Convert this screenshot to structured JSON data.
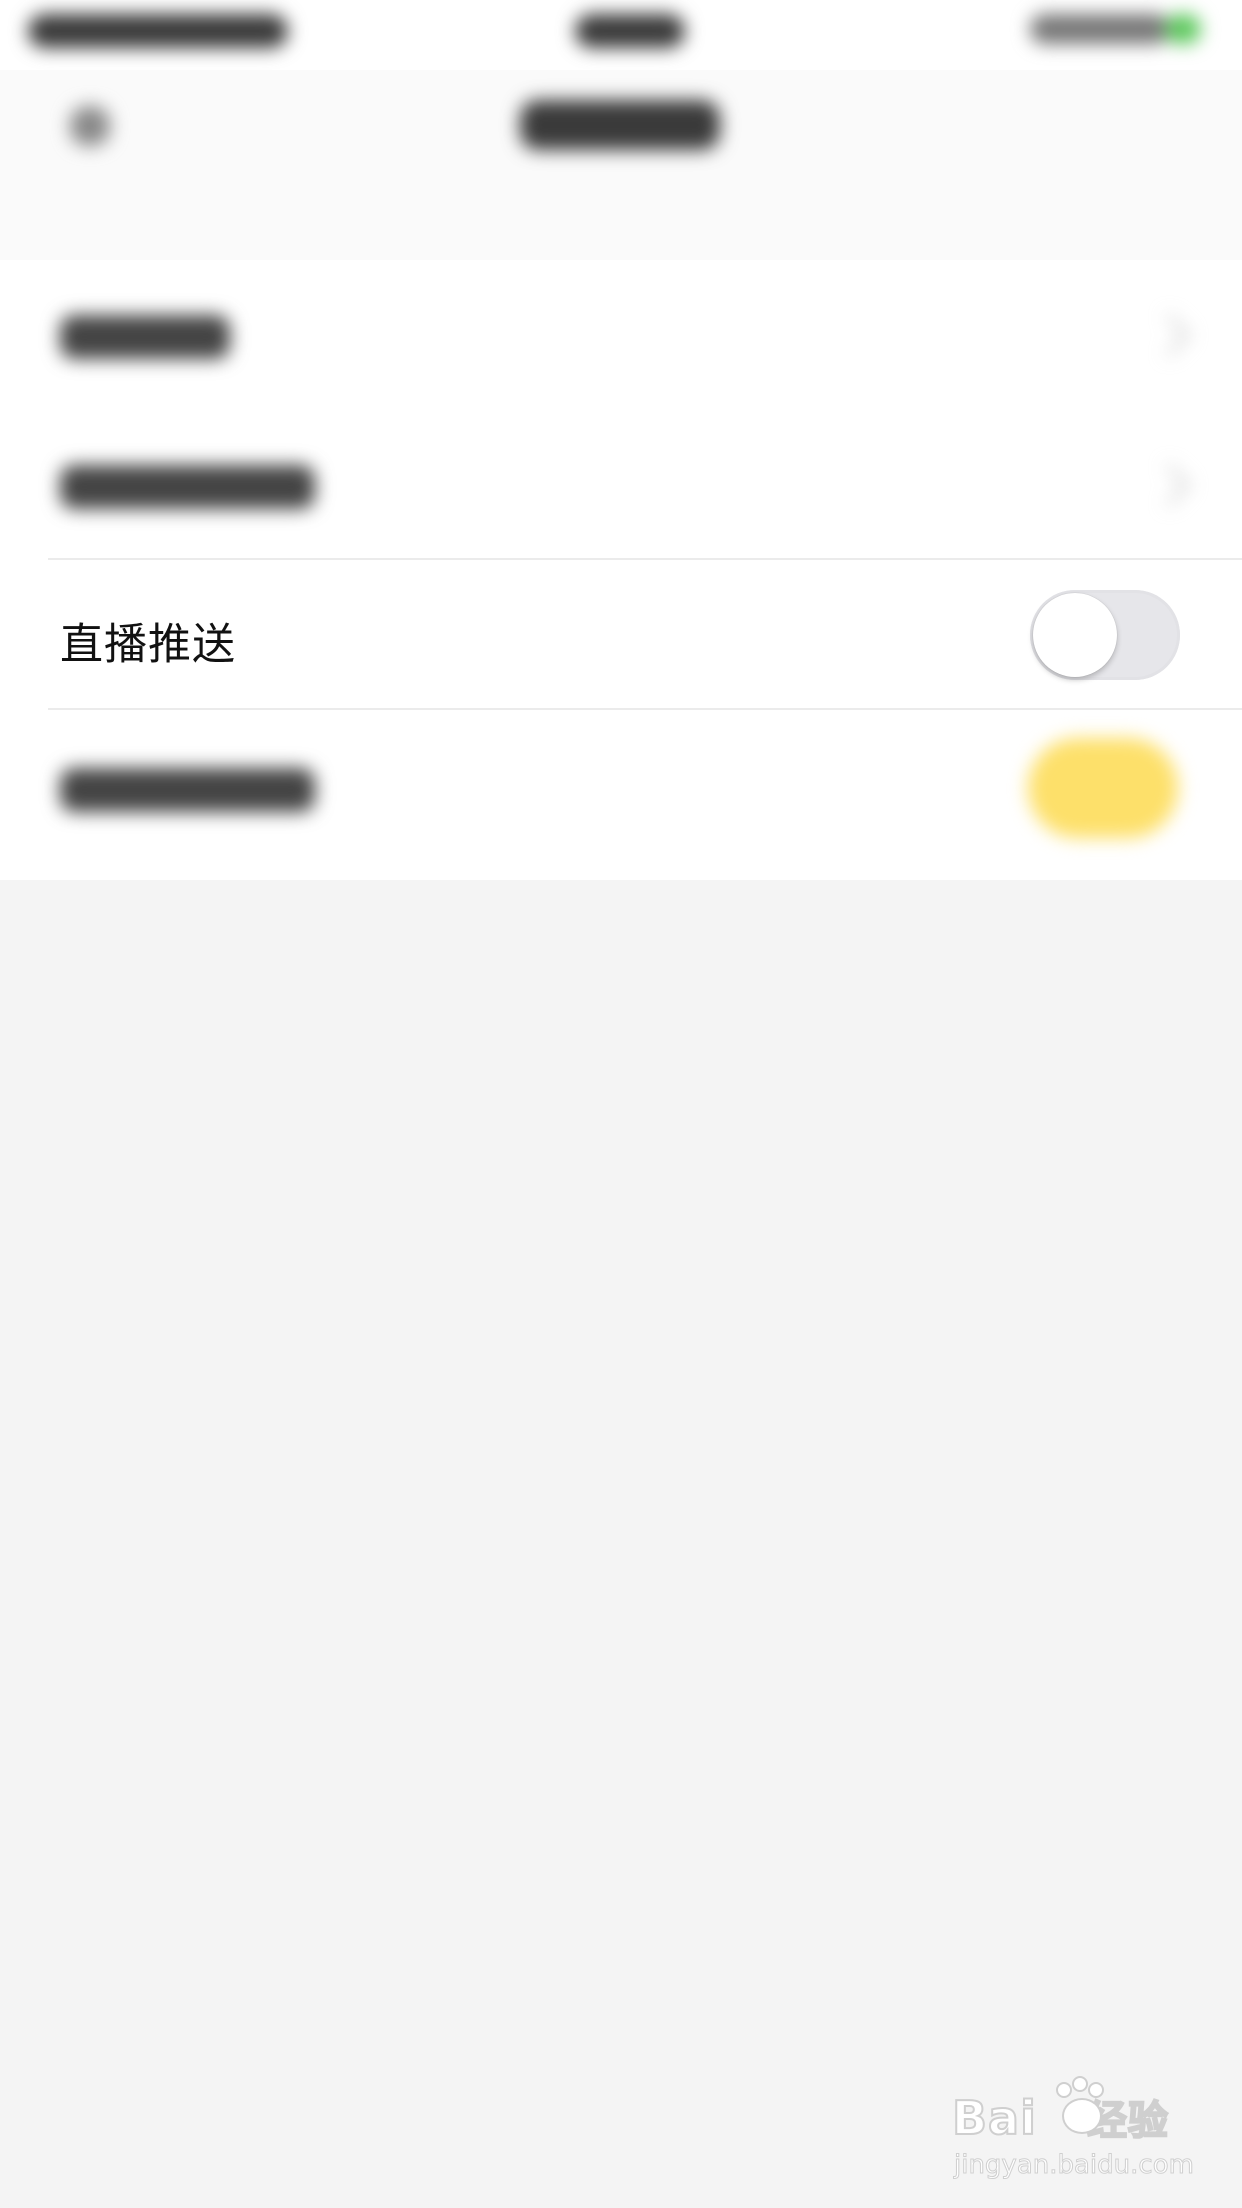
{
  "settings": {
    "live_push": {
      "label": "直播推送",
      "toggle_on": false
    }
  },
  "watermark": {
    "brand": "Bai",
    "brand_cn": "经验",
    "url": "jingyan.baidu.com"
  },
  "colors": {
    "background": "#f4f4f4",
    "toggle_off_track": "#e6e6ea",
    "blurred_toggle_on": "#fde06a"
  }
}
